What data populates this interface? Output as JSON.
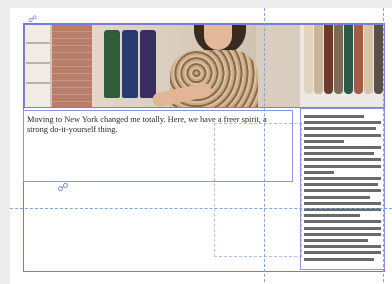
{
  "document": {
    "body_text": "Moving to New York changed me totally. Here, we have a freer spirit, a strong do-it-yourself thing."
  },
  "icons": {
    "thread_link": "link-icon",
    "frame_marker": "link-icon"
  },
  "colors": {
    "frame_guide": "#7a7fd6",
    "margin_guide": "#d64fb0",
    "ruler_guide": "#7ea6d9",
    "page": "#ffffff"
  }
}
